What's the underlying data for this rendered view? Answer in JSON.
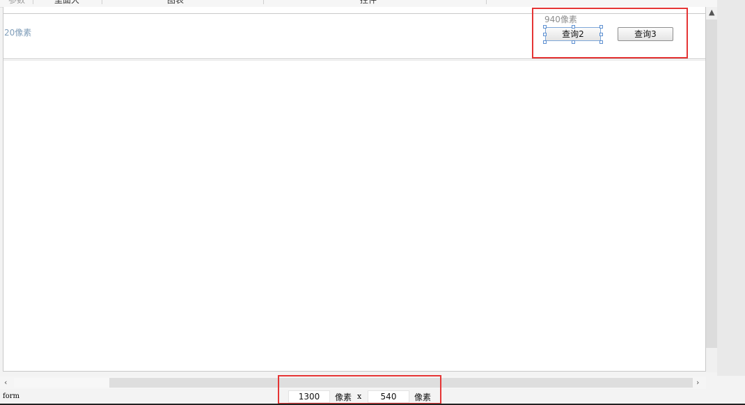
{
  "top_tabs": {
    "tab_0": "参数",
    "tab_1": "里面大",
    "tab_2": "图表",
    "tab_3": "控件"
  },
  "canvas": {
    "left_width_label": "20像素",
    "right_width_label": "940像素",
    "query2_label": "查询2",
    "query3_label": "查询3"
  },
  "statusbar": {
    "element_label": "form",
    "width_value": "1300",
    "height_value": "540",
    "unit_label": "像素",
    "times_label": "x"
  },
  "colors": {
    "highlight_red": "#e53434",
    "selection_blue": "#5c8fd1",
    "label_blue": "#7f9db9"
  },
  "icons": {
    "scroll_up": "chevron-up-icon",
    "scroll_down": "chevron-down-icon",
    "scroll_left": "chevron-left-icon",
    "scroll_right": "chevron-right-icon"
  }
}
